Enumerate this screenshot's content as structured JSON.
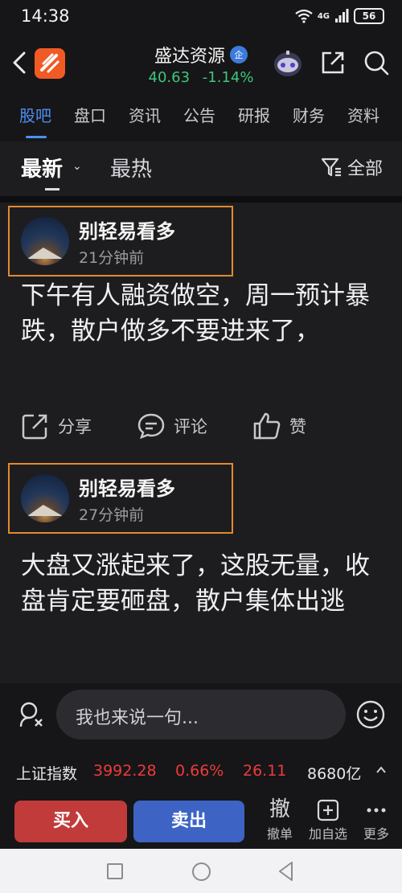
{
  "status_bar": {
    "time": "14:38",
    "network": "4G",
    "battery": "56"
  },
  "header": {
    "stock_name": "盛达资源",
    "badge": "企",
    "price": "40.63",
    "change_pct": "-1.14%"
  },
  "tabs": [
    {
      "label": "股吧",
      "active": true
    },
    {
      "label": "盘口"
    },
    {
      "label": "资讯"
    },
    {
      "label": "公告"
    },
    {
      "label": "研报"
    },
    {
      "label": "财务"
    },
    {
      "label": "资料"
    }
  ],
  "sort": {
    "latest": "最新",
    "hot": "最热",
    "filter_label": "全部"
  },
  "posts": [
    {
      "user": "别轻易看多",
      "time": "21分钟前",
      "body": "下午有人融资做空，周一预计暴跌，散户做多不要进来了，"
    },
    {
      "user": "别轻易看多",
      "time": "27分钟前",
      "body": "大盘又涨起来了，这股无量，收盘肯定要砸盘，散户集体出逃"
    }
  ],
  "actions": {
    "share": "分享",
    "comment": "评论",
    "like": "赞"
  },
  "comment": {
    "placeholder": "我也来说一句..."
  },
  "ticker": {
    "name": "上证指数",
    "value": "3992.28",
    "pct": "0.66%",
    "change": "26.11",
    "amount": "8680亿"
  },
  "trade": {
    "buy": "买入",
    "sell": "卖出",
    "cancel_glyph": "撤",
    "cancel_label": "撤单",
    "watch_label": "加自选",
    "more_label": "更多"
  },
  "colors": {
    "accent": "#4d8ff3",
    "down": "#3ec67a",
    "up": "#ef3a3a",
    "highlight": "#e4892f"
  }
}
